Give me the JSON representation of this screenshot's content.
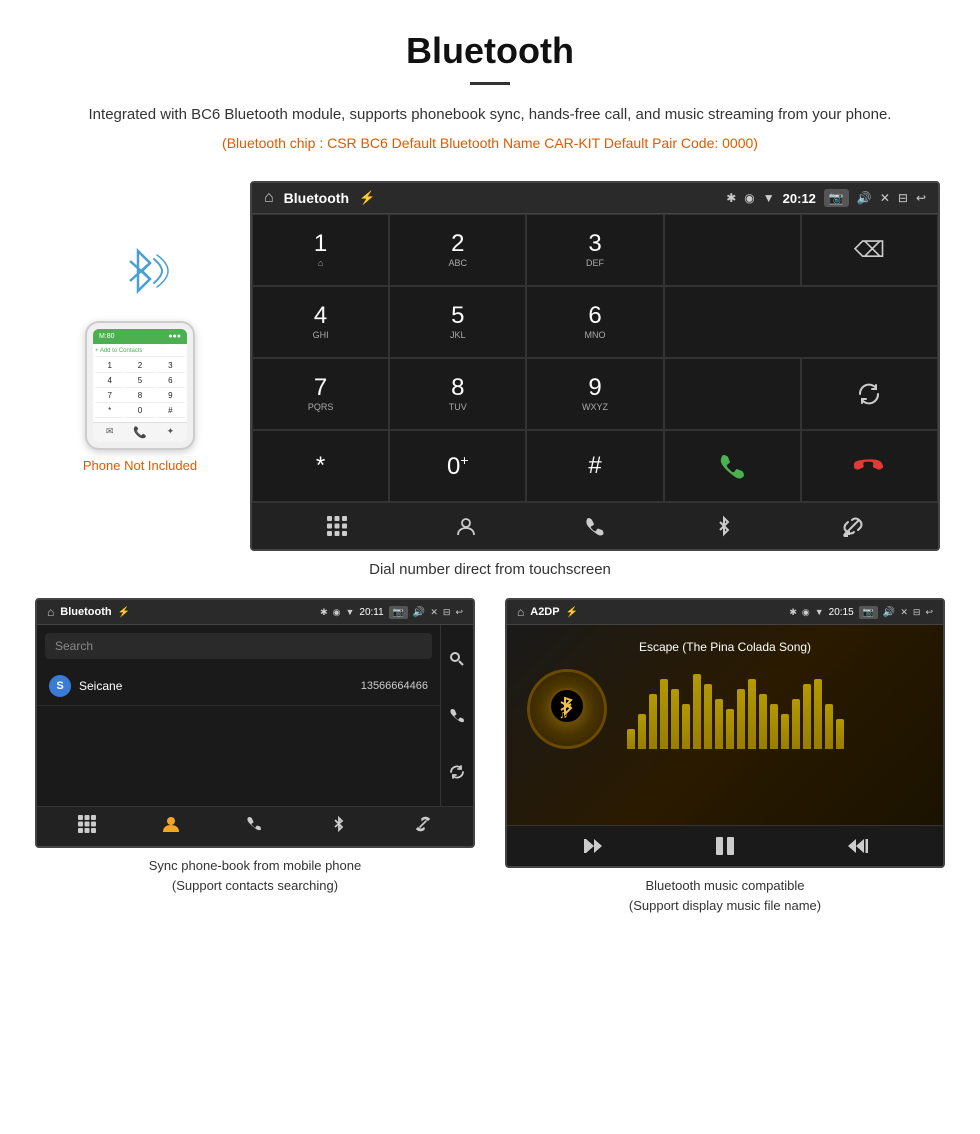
{
  "page": {
    "title": "Bluetooth",
    "description": "Integrated with BC6 Bluetooth module, supports phonebook sync, hands-free call, and music streaming from your phone.",
    "specs": "(Bluetooth chip : CSR BC6    Default Bluetooth Name CAR-KIT    Default Pair Code: 0000)"
  },
  "dial_screen": {
    "header_title": "Bluetooth",
    "time": "20:12",
    "keys": [
      {
        "num": "1",
        "sub": "⌂"
      },
      {
        "num": "2",
        "sub": "ABC"
      },
      {
        "num": "3",
        "sub": "DEF"
      },
      {
        "num": "4",
        "sub": "GHI"
      },
      {
        "num": "5",
        "sub": "JKL"
      },
      {
        "num": "6",
        "sub": "MNO"
      },
      {
        "num": "7",
        "sub": "PQRS"
      },
      {
        "num": "8",
        "sub": "TUV"
      },
      {
        "num": "9",
        "sub": "WXYZ"
      },
      {
        "num": "*",
        "sub": ""
      },
      {
        "num": "0",
        "sub": "+"
      },
      {
        "num": "#",
        "sub": ""
      }
    ],
    "caption": "Dial number direct from touchscreen"
  },
  "phone_mockup": {
    "not_included_label": "Phone Not Included",
    "keys": [
      "1",
      "2",
      "3",
      "4",
      "5",
      "6",
      "7",
      "8",
      "9",
      "*",
      "0",
      "#"
    ]
  },
  "phonebook_screen": {
    "header_title": "Bluetooth",
    "time": "20:11",
    "search_placeholder": "Search",
    "contact": {
      "letter": "S",
      "name": "Seicane",
      "number": "13566664466"
    },
    "caption_line1": "Sync phone-book from mobile phone",
    "caption_line2": "(Support contacts searching)"
  },
  "a2dp_screen": {
    "header_title": "A2DP",
    "time": "20:15",
    "song_title": "Escape (The Pina Colada Song)",
    "eq_bars": [
      20,
      35,
      55,
      70,
      60,
      45,
      75,
      65,
      50,
      40,
      60,
      70,
      55,
      45,
      35,
      50,
      65,
      70,
      45,
      30
    ],
    "caption_line1": "Bluetooth music compatible",
    "caption_line2": "(Support display music file name)"
  }
}
